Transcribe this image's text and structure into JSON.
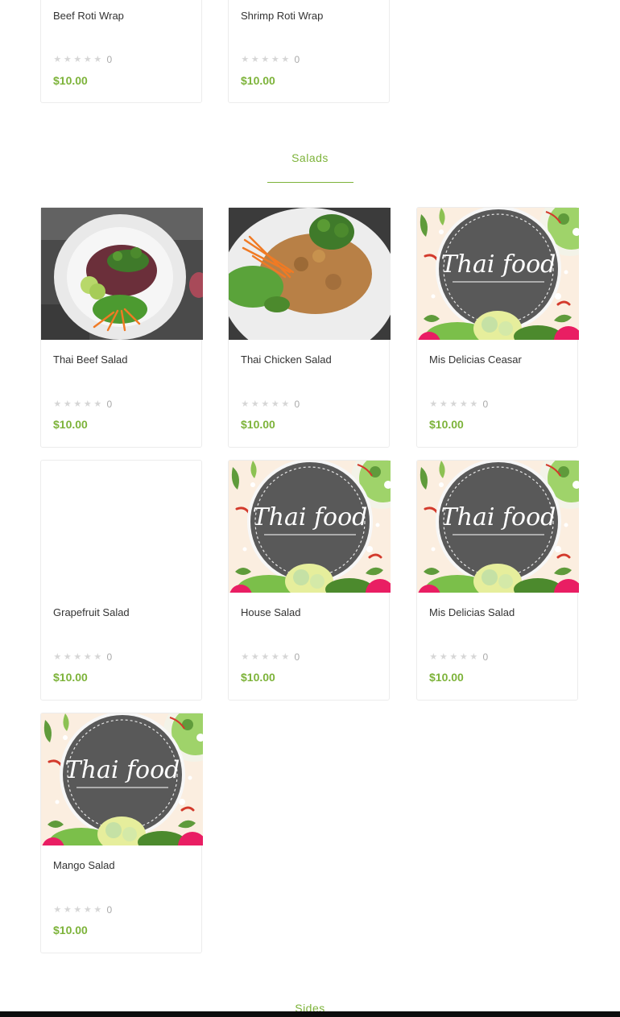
{
  "wraps": {
    "items": [
      {
        "name": "Beef Roti Wrap",
        "rating": 0,
        "price": "$10.00"
      },
      {
        "name": "Shrimp Roti Wrap",
        "rating": 0,
        "price": "$10.00"
      }
    ]
  },
  "salads": {
    "title": "Salads",
    "items": [
      {
        "name": "Thai Beef Salad",
        "rating": 0,
        "price": "$10.00",
        "image": "beef-salad-photo"
      },
      {
        "name": "Thai Chicken Salad",
        "rating": 0,
        "price": "$10.00",
        "image": "chicken-salad-photo"
      },
      {
        "name": "Mis Delicias Ceasar",
        "rating": 0,
        "price": "$10.00",
        "image": "thai-food-placeholder",
        "image_text": "Thai food"
      },
      {
        "name": "Grapefruit Salad",
        "rating": 0,
        "price": "$10.00",
        "image": "none"
      },
      {
        "name": "House Salad",
        "rating": 0,
        "price": "$10.00",
        "image": "thai-food-placeholder",
        "image_text": "Thai food"
      },
      {
        "name": "Mis Delicias Salad",
        "rating": 0,
        "price": "$10.00",
        "image": "thai-food-placeholder",
        "image_text": "Thai food"
      },
      {
        "name": "Mango Salad",
        "rating": 0,
        "price": "$10.00",
        "image": "thai-food-placeholder",
        "image_text": "Thai food"
      }
    ]
  },
  "sides": {
    "title": "Sides"
  },
  "colors": {
    "accent": "#7db33a",
    "star_empty": "#d6d6d6",
    "card_border": "#ececec"
  }
}
